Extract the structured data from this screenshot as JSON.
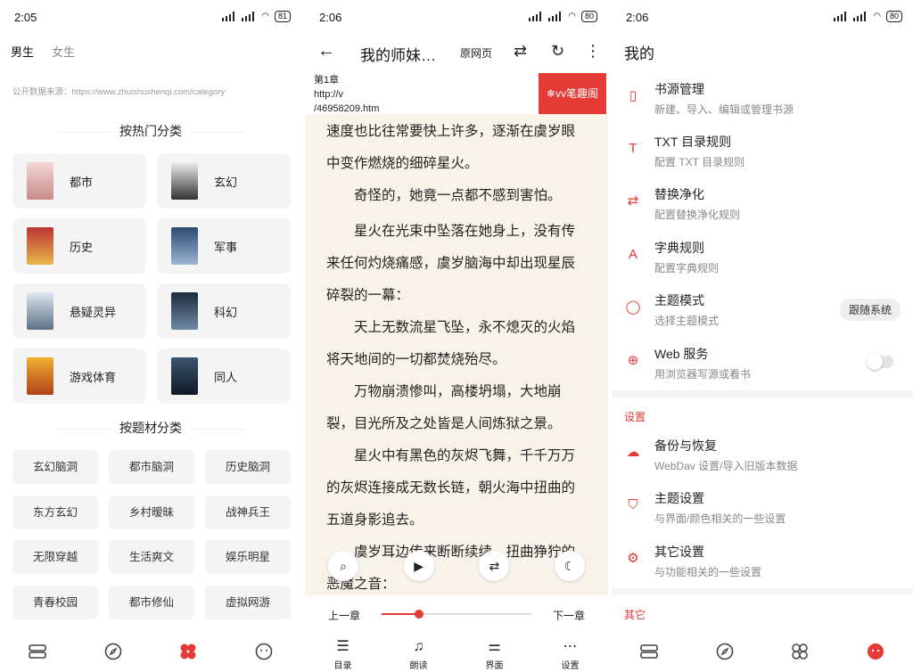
{
  "colors": {
    "accent": "#e53935",
    "page_bg": "#f7f3ea",
    "chip_bg": "#f4f4f4"
  },
  "statusbar": [
    {
      "time": "2:05",
      "battery": "81"
    },
    {
      "time": "2:06",
      "battery": "80"
    },
    {
      "time": "2:06",
      "battery": "80"
    }
  ],
  "explore": {
    "tabs": [
      "男生",
      "女生"
    ],
    "source_note": "公开数据来源：https://www.zhuishushenqi.com/category",
    "hot_heading": "按热门分类",
    "hot_categories": [
      "都市",
      "玄幻",
      "历史",
      "军事",
      "悬疑灵异",
      "科幻",
      "游戏体育",
      "同人"
    ],
    "topic_heading": "按题材分类",
    "topics": [
      "玄幻脑洞",
      "都市脑洞",
      "历史脑洞",
      "东方玄幻",
      "乡村暧昧",
      "战神兵王",
      "无限穿越",
      "生活爽文",
      "娱乐明星",
      "青春校园",
      "都市修仙",
      "虚拟网游"
    ],
    "nav_icons": [
      "bookshelf-icon",
      "compass-icon",
      "category-icon",
      "face-icon"
    ]
  },
  "reader": {
    "title": "我的师妹…",
    "original_page": "原网页",
    "chapter": "第1章",
    "url_line1": "http://v",
    "url_line2": "/46958209.htm",
    "badge": "❄vv笔趣阁",
    "paragraphs": [
      "速度也比往常要快上许多，逐渐在虞岁眼中变作燃烧的细碎星火。",
      "奇怪的，她竟一点都不感到害怕。",
      "星火在光束中坠落在她身上，没有传来任何灼烧痛感，虞岁脑海中却出现星辰碎裂的一幕：",
      "天上无数流星飞坠，永不熄灭的火焰将天地间的一切都焚烧殆尽。",
      "万物崩溃惨叫，高楼坍塌，大地崩裂，目光所及之处皆是人间炼狱之景。",
      "星火中有黑色的灰烬飞舞，千千万万的灰烬连接成无数长链，朝火海中扭曲的五道身影追去。",
      "虞岁耳边传来断断续续，扭曲狰狞的恶魔之音："
    ],
    "prev_chapter": "上一章",
    "next_chapter": "下一章",
    "progress": 0.25,
    "tools": [
      "目录",
      "朗读",
      "界面",
      "设置"
    ]
  },
  "my": {
    "title": "我的",
    "items": [
      {
        "title": "书源管理",
        "sub": "新建、导入、编辑或管理书源",
        "icon": "book-icon"
      },
      {
        "title": "TXT 目录规则",
        "sub": "配置 TXT 目录规则",
        "icon": "txt-icon"
      },
      {
        "title": "替换净化",
        "sub": "配置替换净化规则",
        "icon": "replace-icon"
      },
      {
        "title": "字典规则",
        "sub": "配置字典规则",
        "icon": "dictionary-icon"
      },
      {
        "title": "主题模式",
        "sub": "选择主题模式",
        "icon": "theme-mode-icon",
        "pill": "跟随系统"
      },
      {
        "title": "Web 服务",
        "sub": "用浏览器写源或看书",
        "icon": "web-icon",
        "toggle": false
      }
    ],
    "settings_heading": "设置",
    "settings": [
      {
        "title": "备份与恢复",
        "sub": "WebDav 设置/导入旧版本数据",
        "icon": "cloud-icon"
      },
      {
        "title": "主题设置",
        "sub": "与界面/颜色相关的一些设置",
        "icon": "shirt-icon"
      },
      {
        "title": "其它设置",
        "sub": "与功能相关的一些设置",
        "icon": "settings-icon"
      }
    ],
    "other_heading": "其它"
  }
}
